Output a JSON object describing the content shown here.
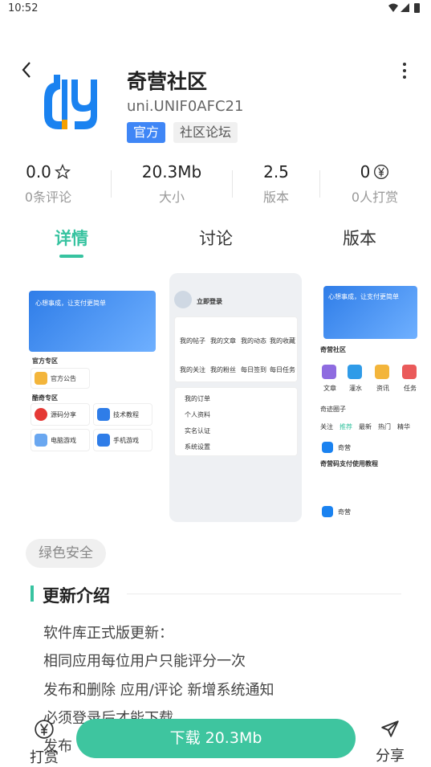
{
  "status_bar": {
    "time": "10:52"
  },
  "app": {
    "name": "奇营社区",
    "package": "uni.UNIF0AFC21",
    "tags": [
      "官方",
      "社区论坛"
    ]
  },
  "stats": [
    {
      "value": "0.0",
      "label": "0条评论",
      "icon": "star-icon"
    },
    {
      "value": "20.3Mb",
      "label": "大小"
    },
    {
      "value": "2.5",
      "label": "版本"
    },
    {
      "value": "0",
      "label": "0人打赏",
      "icon": "yen-icon"
    }
  ],
  "tabs": [
    "详情",
    "讨论",
    "版本"
  ],
  "active_tab": 0,
  "screenshot1": {
    "banner_text": "心想事成，让支付更简单",
    "section_official": "官方专区",
    "official_item": "官方公告",
    "section_cool": "酷奇专区",
    "items": [
      "源码分享",
      "技术教程",
      "电脑游戏",
      "手机游戏"
    ]
  },
  "screenshot2": {
    "login": "立即登录",
    "grid": [
      "我的帖子",
      "我的文章",
      "我的动态",
      "我的收藏",
      "我的关注",
      "我的粉丝",
      "每日签到",
      "每日任务"
    ],
    "list": [
      "我的订单",
      "个人资料",
      "实名认证",
      "系统设置"
    ]
  },
  "screenshot3": {
    "banner_text": "心想事成，让支付更简单",
    "section": "奇营社区",
    "cats": [
      "文章",
      "灌水",
      "资讯",
      "任务"
    ],
    "circle": "奇迹圈子",
    "tabs": [
      "关注",
      "推荐",
      "最新",
      "热门",
      "精华"
    ],
    "post_title": "奇营码支付使用教程",
    "post_author": "奇营"
  },
  "safe_badge": "绿色安全",
  "update": {
    "title": "更新介绍",
    "lines": [
      "软件库正式版更新：",
      "相同应用每位用户只能评分一次",
      "发布和删除 应用/评论 新增系统通知",
      "必须登录后才能下载",
      "发布"
    ]
  },
  "bottom": {
    "tip_label": "打赏",
    "download_label": "下载 20.3Mb",
    "share_label": "分享"
  },
  "colors": {
    "accent": "#3ec59f",
    "brand_blue": "#1a82f0",
    "official_tag": "#3f86f6"
  }
}
